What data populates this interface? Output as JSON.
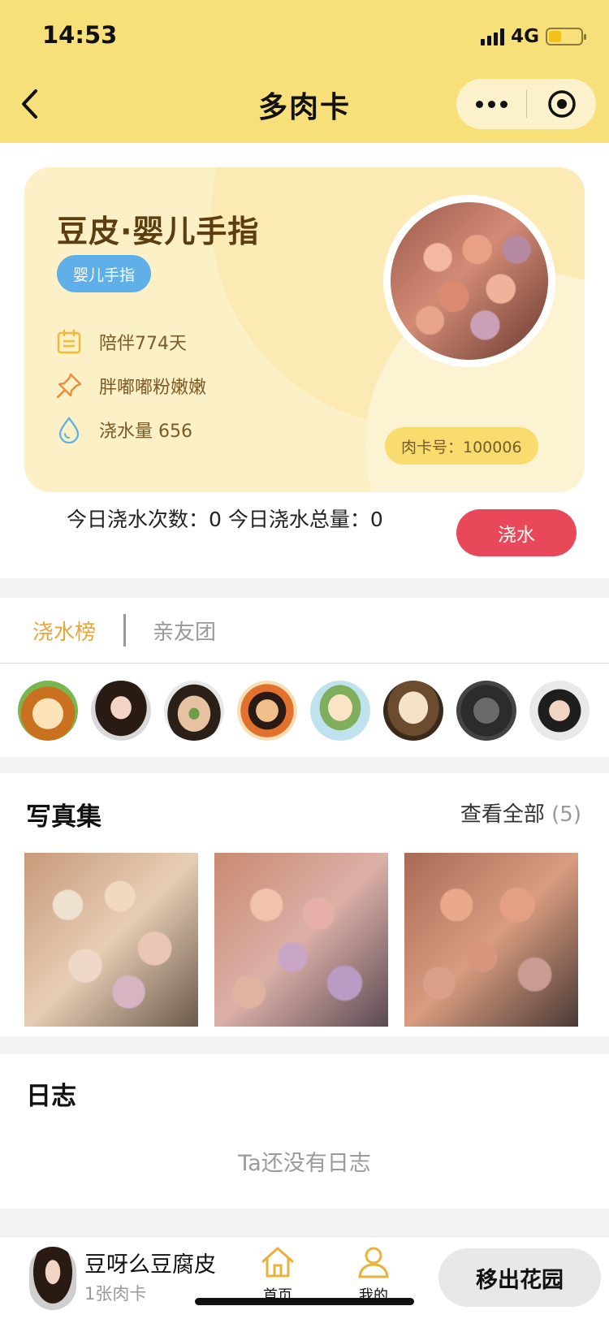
{
  "status": {
    "time": "14:53",
    "network": "4G",
    "battery_level": 0.4
  },
  "nav": {
    "title": "多肉卡"
  },
  "card": {
    "name": "豆皮·婴儿手指",
    "variety_tag": "婴儿手指",
    "companion": "陪伴774天",
    "description": "胖嘟嘟粉嫩嫩",
    "water": "浇水量 656",
    "card_number": "肉卡号：100006"
  },
  "today": {
    "summary": "今日浇水次数：0 今日浇水总量：0",
    "water_button": "浇水"
  },
  "tabs": {
    "ranking": "浇水榜",
    "friends": "亲友团"
  },
  "album": {
    "title": "写真集",
    "view_all": "查看全部",
    "count": "(5)"
  },
  "diary": {
    "title": "日志",
    "empty": "Ta还没有日志"
  },
  "bottom": {
    "owner_name": "豆呀么豆腐皮",
    "owner_cards": "1张肉卡",
    "home": "首页",
    "mine": "我的",
    "remove": "移出花园"
  },
  "colors": {
    "header_yellow": "#f7df7a",
    "card_bg": "#fcf0c6",
    "accent_red": "#e9475a",
    "tag_blue": "#5fb0e8",
    "tab_active": "#e9a63a"
  }
}
